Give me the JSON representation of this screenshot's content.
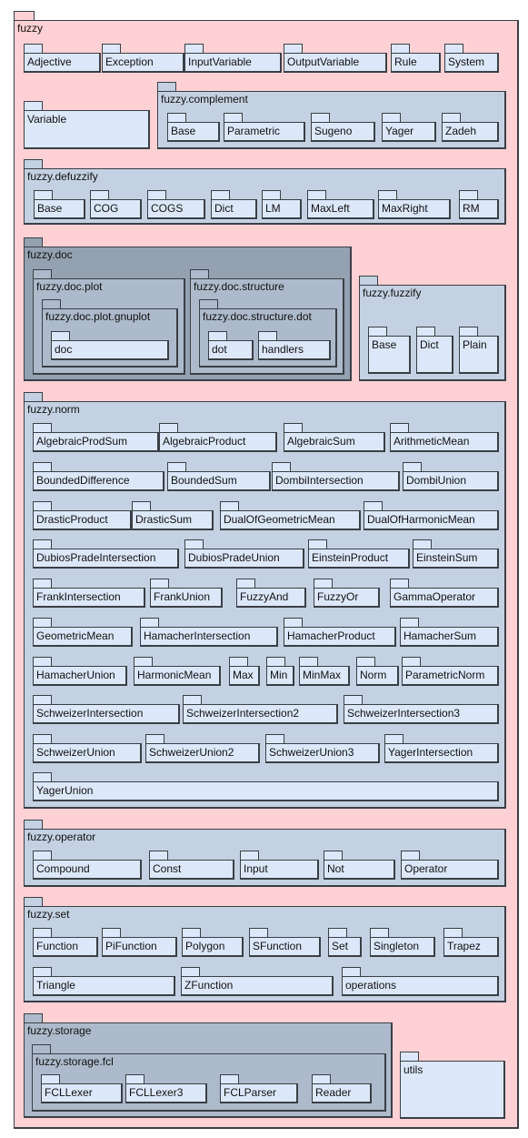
{
  "diagram": {
    "type": "uml-package-diagram",
    "colors": {
      "root": "#ffd1d4",
      "subpackage": "#c4d1e2",
      "nested_dark": "#94a1b1",
      "nested_mid": "#adbacb",
      "leaf": "#dce8fa",
      "border": "#3a3f46"
    },
    "root": {
      "name": "fuzzy",
      "modules": [
        "Adjective",
        "Exception",
        "InputVariable",
        "OutputVariable",
        "Rule",
        "System",
        "Variable"
      ],
      "packages": {
        "complement": {
          "name": "fuzzy.complement",
          "modules": [
            "Base",
            "Parametric",
            "Sugeno",
            "Yager",
            "Zadeh"
          ]
        },
        "defuzzify": {
          "name": "fuzzy.defuzzify",
          "modules": [
            "Base",
            "COG",
            "COGS",
            "Dict",
            "LM",
            "MaxLeft",
            "MaxRight",
            "RM"
          ]
        },
        "doc": {
          "name": "fuzzy.doc",
          "plot": {
            "name": "fuzzy.doc.plot",
            "gnuplot": {
              "name": "fuzzy.doc.plot.gnuplot",
              "modules": [
                "doc"
              ]
            }
          },
          "structure": {
            "name": "fuzzy.doc.structure",
            "dot": {
              "name": "fuzzy.doc.structure.dot",
              "modules": [
                "dot",
                "handlers"
              ]
            }
          }
        },
        "fuzzify": {
          "name": "fuzzy.fuzzify",
          "modules": [
            "Base",
            "Dict",
            "Plain"
          ]
        },
        "norm": {
          "name": "fuzzy.norm",
          "modules": [
            "AlgebraicProdSum",
            "AlgebraicProduct",
            "AlgebraicSum",
            "ArithmeticMean",
            "BoundedDifference",
            "BoundedSum",
            "DombiIntersection",
            "DombiUnion",
            "DrasticProduct",
            "DrasticSum",
            "DualOfGeometricMean",
            "DualOfHarmonicMean",
            "DubiosPradeIntersection",
            "DubiosPradeUnion",
            "EinsteinProduct",
            "EinsteinSum",
            "FrankIntersection",
            "FrankUnion",
            "FuzzyAnd",
            "FuzzyOr",
            "GammaOperator",
            "GeometricMean",
            "HamacherIntersection",
            "HamacherProduct",
            "HamacherSum",
            "HamacherUnion",
            "HarmonicMean",
            "Max",
            "Min",
            "MinMax",
            "Norm",
            "ParametricNorm",
            "SchweizerIntersection",
            "SchweizerIntersection2",
            "SchweizerIntersection3",
            "SchweizerUnion",
            "SchweizerUnion2",
            "SchweizerUnion3",
            "YagerIntersection",
            "YagerUnion"
          ]
        },
        "operator": {
          "name": "fuzzy.operator",
          "modules": [
            "Compound",
            "Const",
            "Input",
            "Not",
            "Operator"
          ]
        },
        "set": {
          "name": "fuzzy.set",
          "modules": [
            "Function",
            "PiFunction",
            "Polygon",
            "SFunction",
            "Set",
            "Singleton",
            "Trapez",
            "Triangle",
            "ZFunction",
            "operations"
          ]
        },
        "storage": {
          "name": "fuzzy.storage",
          "fcl": {
            "name": "fuzzy.storage.fcl",
            "modules": [
              "FCLLexer",
              "FCLLexer3",
              "FCLParser",
              "Reader"
            ]
          }
        }
      }
    },
    "utils": {
      "name": "utils"
    }
  }
}
